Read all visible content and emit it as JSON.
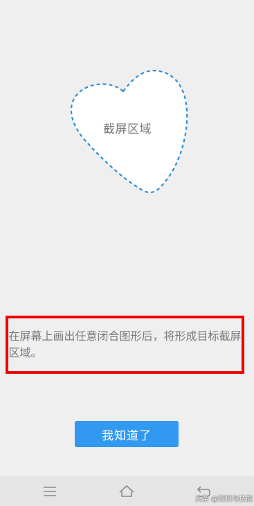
{
  "screenshot_area": {
    "label": "截屏区域",
    "outline_color": "#2f8fd8",
    "shape": "heart"
  },
  "instruction": {
    "text": "在屏幕上画出任意闭合图形后，将形成目标截屏区域。",
    "highlight_color": "#ee0000"
  },
  "confirm_button": {
    "label": "我知道了",
    "color": "#3299f0"
  },
  "navbar": {
    "menu_icon": "menu-icon",
    "home_icon": "home-icon",
    "back_icon": "back-icon"
  },
  "watermark": {
    "text": "头条 @知识与技能"
  }
}
